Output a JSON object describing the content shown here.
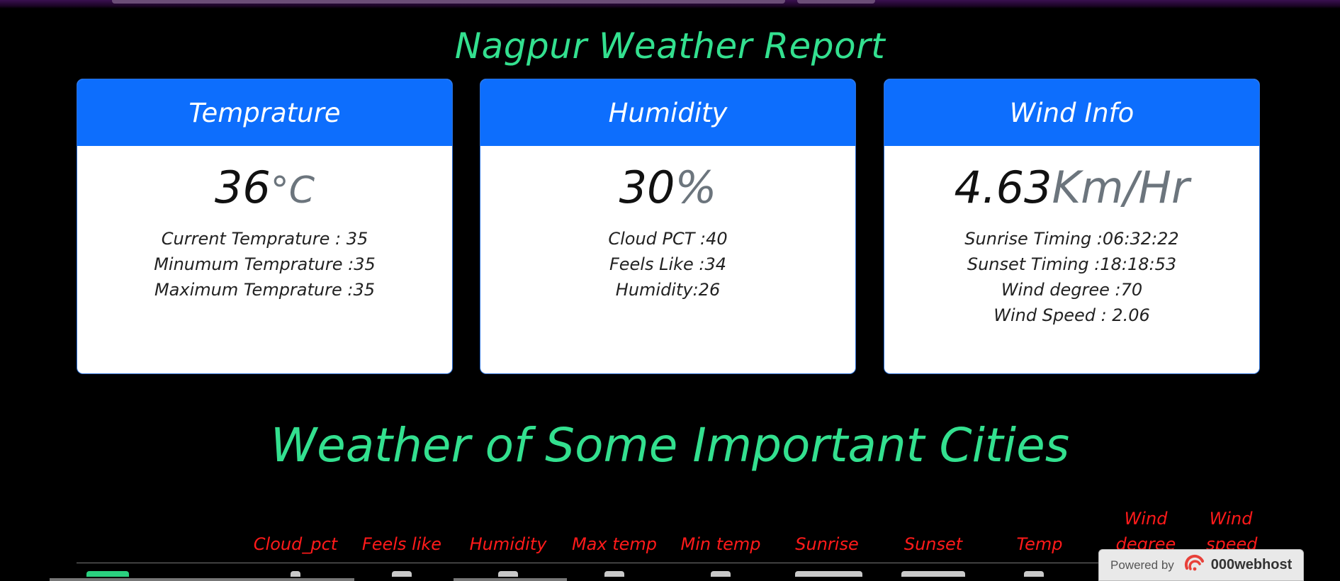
{
  "page": {
    "title": "Nagpur Weather Report",
    "section_title": "Weather of Some Important Cities"
  },
  "cards": {
    "temperature": {
      "header": "Temprature",
      "value": "36",
      "unit": "°C",
      "lines": [
        "Current Temprature : 35",
        "Minumum Temprature :35",
        "Maximum Temprature :35"
      ]
    },
    "humidity": {
      "header": "Humidity",
      "value": "30",
      "unit": "%",
      "lines": [
        "Cloud PCT :40",
        "Feels Like :34",
        "Humidity:26"
      ]
    },
    "wind": {
      "header": "Wind Info",
      "value": "4.63",
      "unit": "Km/Hr",
      "lines": [
        "Sunrise Timing :06:32:22",
        "Sunset Timing :18:18:53",
        "Wind degree :70",
        "Wind Speed : 2.06"
      ]
    }
  },
  "table": {
    "headers": [
      "Cloud_pct",
      "Feels like",
      "Humidity",
      "Max temp",
      "Min temp",
      "Sunrise",
      "Sunset",
      "Temp",
      "Wind degree",
      "Wind speed"
    ]
  },
  "badge": {
    "powered": "Powered by",
    "host": "000webhost"
  },
  "colors": {
    "accent_green": "#33e08f",
    "header_blue": "#0d6efd",
    "table_header_red": "#ff1a1a"
  }
}
